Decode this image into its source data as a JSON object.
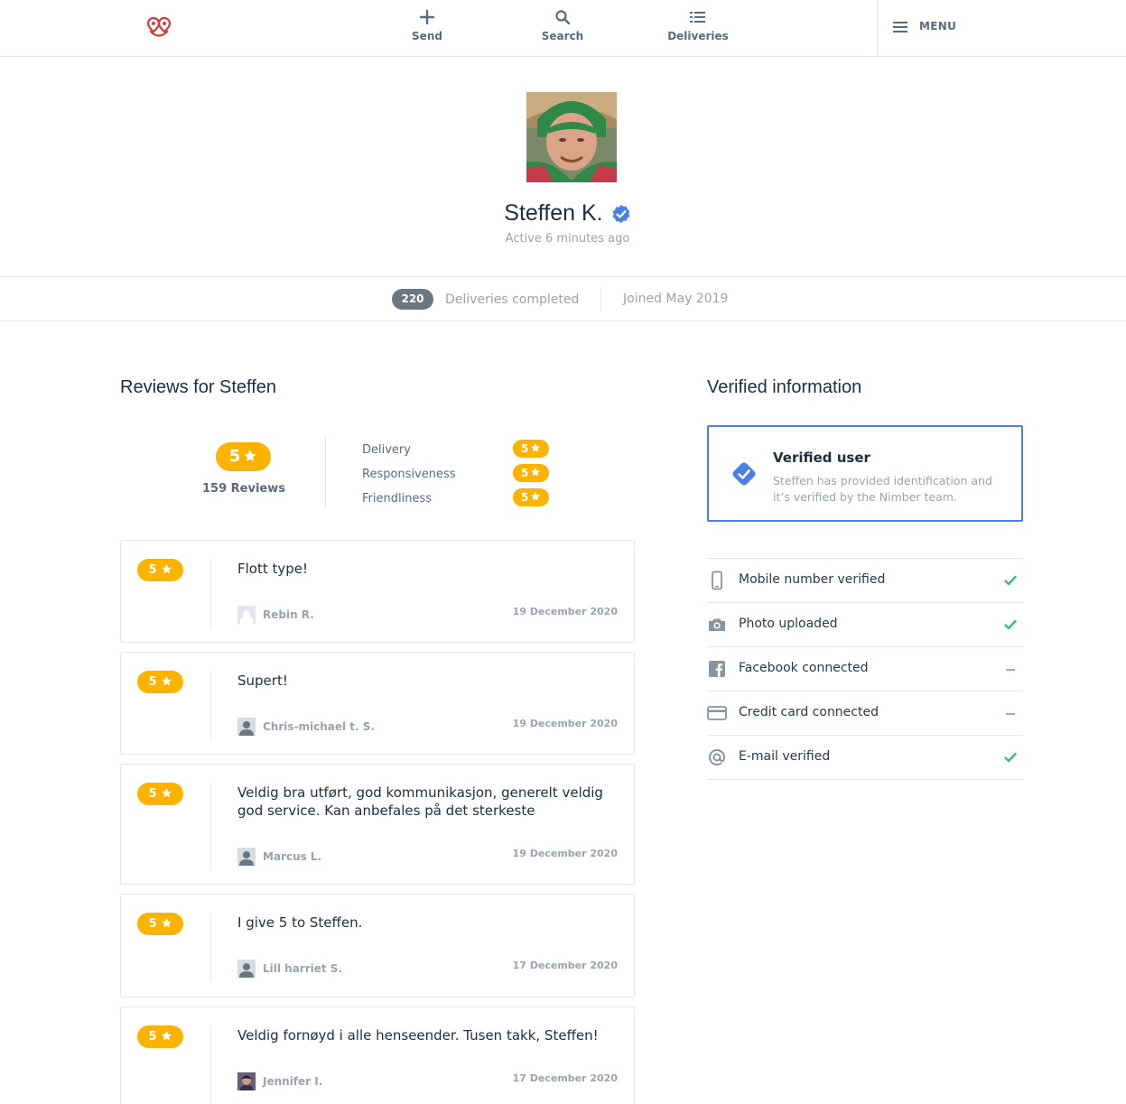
{
  "nav": {
    "send_label": "Send",
    "search_label": "Search",
    "deliveries_label": "Deliveries",
    "menu_label": "MENU"
  },
  "profile": {
    "name": "Steffen K.",
    "active": "Active 6 minutes ago",
    "deliveries_count": "220",
    "deliveries_label": "Deliveries completed",
    "joined": "Joined May 2019"
  },
  "reviews": {
    "title": "Reviews for Steffen",
    "overall_rating": "5",
    "count_label": "159 Reviews",
    "categories": [
      {
        "label": "Delivery",
        "rating": "5"
      },
      {
        "label": "Responsiveness",
        "rating": "5"
      },
      {
        "label": "Friendliness",
        "rating": "5"
      }
    ],
    "items": [
      {
        "rating": "5",
        "text": "Flott type!",
        "reviewer": "Rebin R.",
        "date": "19 December 2020",
        "avatar": "placeholder-outline"
      },
      {
        "rating": "5",
        "text": "Supert!",
        "reviewer": "Chris-michael t. S.",
        "date": "19 December 2020",
        "avatar": "placeholder-person"
      },
      {
        "rating": "5",
        "text": "Veldig bra utført, god kommunikasjon, generelt veldig god service. Kan anbefales på det sterkeste",
        "reviewer": "Marcus L.",
        "date": "19 December 2020",
        "avatar": "placeholder-person"
      },
      {
        "rating": "5",
        "text": "I give 5 to Steffen.",
        "reviewer": "Lill harriet S.",
        "date": "17 December 2020",
        "avatar": "placeholder-person"
      },
      {
        "rating": "5",
        "text": "Veldig fornøyd i alle henseender. Tusen takk, Steffen!",
        "reviewer": "Jennifer I.",
        "date": "17 December 2020",
        "avatar": "photo"
      }
    ]
  },
  "verified": {
    "title": "Verified information",
    "box_title": "Verified user",
    "box_text": "Steffen has provided identification and it’s verified by the Nimber team.",
    "items": [
      {
        "label": "Mobile number verified",
        "icon": "phone-icon",
        "status": "verified"
      },
      {
        "label": "Photo uploaded",
        "icon": "camera-icon",
        "status": "verified"
      },
      {
        "label": "Facebook connected",
        "icon": "facebook-icon",
        "status": "not-verified"
      },
      {
        "label": "Credit card connected",
        "icon": "credit-card-icon",
        "status": "not-verified"
      },
      {
        "label": "E-mail verified",
        "icon": "at-sign-icon",
        "status": "verified"
      }
    ]
  },
  "colors": {
    "accent_star": "#fbb300",
    "verified_blue": "#4a7fe5",
    "check_green": "#3bbf6b",
    "logo_red": "#d9393a"
  }
}
